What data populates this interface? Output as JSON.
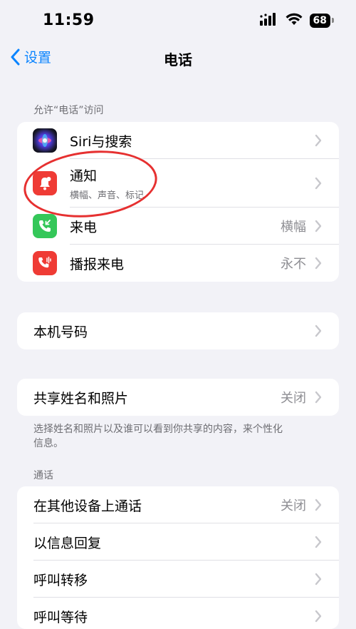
{
  "status": {
    "time": "11:59",
    "battery": "68"
  },
  "nav": {
    "back_label": "设置",
    "title": "电话"
  },
  "section_allow": {
    "label": "允许“电话”访问"
  },
  "allow_items": [
    {
      "label": "Siri与搜索",
      "value": "",
      "icon": "siri-icon"
    },
    {
      "label": "通知",
      "sub": "横幅、声音、标记",
      "value": "",
      "icon": "notification-bell-icon"
    },
    {
      "label": "来电",
      "value": "横幅",
      "icon": "incoming-call-icon"
    },
    {
      "label": "播报来电",
      "value": "永不",
      "icon": "announce-calls-icon"
    }
  ],
  "my_number": {
    "label": "本机号码"
  },
  "share": {
    "label": "共享姓名和照片",
    "value": "关闭",
    "note": "选择姓名和照片以及谁可以看到你共享的内容，来个性化信息。"
  },
  "section_calls": {
    "label": "通话"
  },
  "call_items": [
    {
      "label": "在其他设备上通话",
      "value": "关闭"
    },
    {
      "label": "以信息回复",
      "value": ""
    },
    {
      "label": "呼叫转移",
      "value": ""
    },
    {
      "label": "呼叫等待",
      "value": ""
    }
  ],
  "colors": {
    "accent": "#0a84ff",
    "notification": "#ef3b35",
    "phone_green": "#34c759",
    "announce_red": "#ef3b35",
    "annotation": "#e63030"
  }
}
